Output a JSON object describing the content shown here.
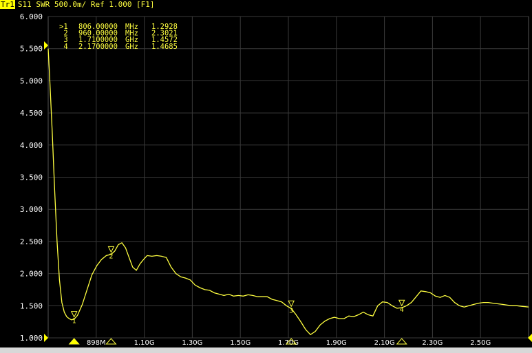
{
  "header": {
    "trace_badge": "Tr1",
    "title": "S11  SWR 500.0m/ Ref 1.000 [F1]"
  },
  "marker_table": [
    {
      "flag": ">1",
      "freq": "806.00000",
      "unit": "MHz",
      "value": "1.2928"
    },
    {
      "flag": " 2",
      "freq": "960.00000",
      "unit": "MHz",
      "value": "2.3021"
    },
    {
      "flag": " 3",
      "freq": "1.7100000",
      "unit": "GHz",
      "value": "1.4572"
    },
    {
      "flag": " 4",
      "freq": "2.1700000",
      "unit": "GHz",
      "value": "1.4685"
    }
  ],
  "colors": {
    "trace": "#ffff40",
    "grid": "#3a3a3a",
    "background": "#000000",
    "tick_text": "#ffffff"
  },
  "chart_data": {
    "type": "line",
    "title": "S11  SWR 500.0m/ Ref 1.000 [F1]",
    "xlabel": "",
    "ylabel": "",
    "xlim": [
      0.698,
      2.698
    ],
    "ylim": [
      1.0,
      6.0
    ],
    "grid": true,
    "y_ticks": [
      "6.000",
      "5.500",
      "5.000",
      "4.500",
      "4.000",
      "3.500",
      "3.000",
      "2.500",
      "2.000",
      "1.500",
      "1.000"
    ],
    "y_tick_values": [
      6.0,
      5.5,
      5.0,
      4.5,
      4.0,
      3.5,
      3.0,
      2.5,
      2.0,
      1.5,
      1.0
    ],
    "x_ticks": [
      "898M",
      "1.10G",
      "1.30G",
      "1.50G",
      "1.70G",
      "1.90G",
      "2.10G",
      "2.30G",
      "2.50G"
    ],
    "x_tick_values": [
      0.898,
      1.098,
      1.298,
      1.498,
      1.698,
      1.898,
      2.098,
      2.298,
      2.498
    ],
    "series": [
      {
        "x": [
          0.698,
          0.705,
          0.715,
          0.725,
          0.735,
          0.745,
          0.755,
          0.765,
          0.775,
          0.785,
          0.795,
          0.806,
          0.82,
          0.84,
          0.86,
          0.88,
          0.9,
          0.92,
          0.94,
          0.96,
          0.975,
          0.99,
          1.005,
          1.02,
          1.035,
          1.05,
          1.065,
          1.08,
          1.095,
          1.11,
          1.13,
          1.15,
          1.17,
          1.19,
          1.21,
          1.23,
          1.25,
          1.27,
          1.29,
          1.31,
          1.33,
          1.35,
          1.37,
          1.39,
          1.41,
          1.43,
          1.45,
          1.47,
          1.49,
          1.51,
          1.53,
          1.55,
          1.57,
          1.59,
          1.61,
          1.63,
          1.65,
          1.67,
          1.69,
          1.71,
          1.73,
          1.75,
          1.77,
          1.79,
          1.81,
          1.83,
          1.85,
          1.87,
          1.89,
          1.91,
          1.93,
          1.95,
          1.97,
          1.99,
          2.01,
          2.03,
          2.05,
          2.07,
          2.09,
          2.11,
          2.13,
          2.15,
          2.17,
          2.19,
          2.21,
          2.23,
          2.25,
          2.27,
          2.29,
          2.31,
          2.33,
          2.35,
          2.37,
          2.39,
          2.41,
          2.43,
          2.45,
          2.47,
          2.49,
          2.51,
          2.53,
          2.55,
          2.57,
          2.59,
          2.61,
          2.63,
          2.65,
          2.67,
          2.698
        ],
        "values": [
          5.5,
          5.0,
          4.2,
          3.3,
          2.5,
          1.9,
          1.55,
          1.4,
          1.33,
          1.3,
          1.28,
          1.29,
          1.35,
          1.52,
          1.75,
          1.98,
          2.12,
          2.22,
          2.28,
          2.3,
          2.35,
          2.45,
          2.48,
          2.4,
          2.25,
          2.1,
          2.05,
          2.15,
          2.22,
          2.28,
          2.27,
          2.28,
          2.27,
          2.25,
          2.1,
          2.0,
          1.95,
          1.93,
          1.9,
          1.82,
          1.78,
          1.75,
          1.74,
          1.7,
          1.68,
          1.66,
          1.68,
          1.65,
          1.66,
          1.65,
          1.67,
          1.66,
          1.64,
          1.64,
          1.64,
          1.6,
          1.58,
          1.56,
          1.5,
          1.457,
          1.36,
          1.25,
          1.13,
          1.05,
          1.1,
          1.2,
          1.26,
          1.3,
          1.32,
          1.3,
          1.3,
          1.34,
          1.33,
          1.36,
          1.4,
          1.36,
          1.34,
          1.5,
          1.56,
          1.55,
          1.5,
          1.46,
          1.4685,
          1.5,
          1.55,
          1.64,
          1.73,
          1.72,
          1.7,
          1.65,
          1.63,
          1.66,
          1.63,
          1.55,
          1.5,
          1.48,
          1.5,
          1.52,
          1.54,
          1.55,
          1.55,
          1.54,
          1.53,
          1.52,
          1.51,
          1.5,
          1.5,
          1.49,
          1.48
        ]
      }
    ],
    "markers": [
      {
        "label": "1",
        "x": 0.806,
        "y": 1.2928
      },
      {
        "label": "2",
        "x": 0.96,
        "y": 2.3021
      },
      {
        "label": "3",
        "x": 1.71,
        "y": 1.4572
      },
      {
        "label": "4",
        "x": 2.17,
        "y": 1.4685
      }
    ]
  }
}
